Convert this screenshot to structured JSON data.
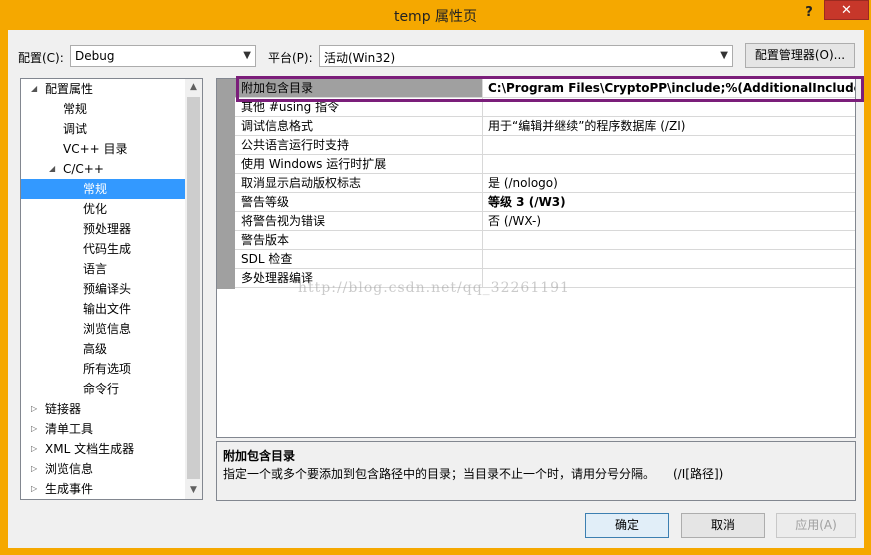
{
  "window": {
    "title": "temp 属性页",
    "help": "?",
    "close": "✕"
  },
  "config_bar": {
    "config_label": "配置(C):",
    "config_value": "Debug",
    "platform_label": "平台(P):",
    "platform_value": "活动(Win32)",
    "manager_button": "配置管理器(O)..."
  },
  "tree": {
    "items": [
      {
        "label": "配置属性",
        "expander": "◢"
      },
      {
        "label": "常规"
      },
      {
        "label": "调试"
      },
      {
        "label": "VC++ 目录"
      },
      {
        "label": "C/C++",
        "expander": "◢"
      },
      {
        "label": "常规",
        "selected": true
      },
      {
        "label": "优化"
      },
      {
        "label": "预处理器"
      },
      {
        "label": "代码生成"
      },
      {
        "label": "语言"
      },
      {
        "label": "预编译头"
      },
      {
        "label": "输出文件"
      },
      {
        "label": "浏览信息"
      },
      {
        "label": "高级"
      },
      {
        "label": "所有选项"
      },
      {
        "label": "命令行"
      },
      {
        "label": "链接器",
        "expander": "▷"
      },
      {
        "label": "清单工具",
        "expander": "▷"
      },
      {
        "label": "XML 文档生成器",
        "expander": "▷"
      },
      {
        "label": "浏览信息",
        "expander": "▷"
      },
      {
        "label": "生成事件",
        "expander": "▷"
      }
    ]
  },
  "grid": {
    "rows": [
      {
        "name": "附加包含目录",
        "value": "C:\\Program Files\\CryptoPP\\include;%(AdditionalIncludeDirec"
      },
      {
        "name": "其他 #using 指令",
        "value": ""
      },
      {
        "name": "调试信息格式",
        "value": "用于“编辑并继续”的程序数据库 (/ZI)"
      },
      {
        "name": "公共语言运行时支持",
        "value": ""
      },
      {
        "name": "使用 Windows 运行时扩展",
        "value": ""
      },
      {
        "name": "取消显示启动版权标志",
        "value": "是 (/nologo)"
      },
      {
        "name": "警告等级",
        "value": "等级 3 (/W3)"
      },
      {
        "name": "将警告视为错误",
        "value": "否 (/WX-)"
      },
      {
        "name": "警告版本",
        "value": ""
      },
      {
        "name": "SDL 检查",
        "value": ""
      },
      {
        "name": "多处理器编译",
        "value": ""
      }
    ]
  },
  "description": {
    "title": "附加包含目录",
    "text": "指定一个或多个要添加到包含路径中的目录；当目录不止一个时，请用分号分隔。　　(/I[路径])"
  },
  "watermark": "http://blog.csdn.net/qq_32261191",
  "buttons": {
    "ok": "确定",
    "cancel": "取消",
    "apply": "应用(A)"
  },
  "colors": {
    "titlebar": "#f5a800",
    "close": "#c7372a",
    "selection": "#3399ff",
    "highlight_border": "#7b1e7a"
  }
}
